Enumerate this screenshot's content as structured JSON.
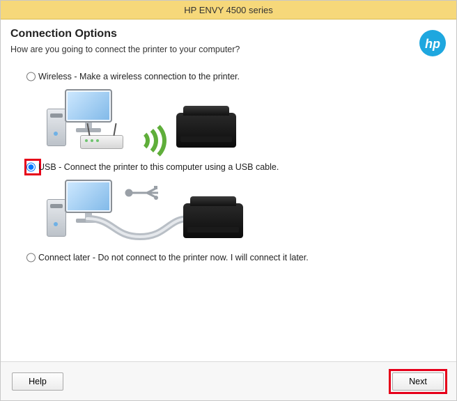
{
  "window": {
    "title": "HP ENVY 4500 series"
  },
  "header": {
    "heading": "Connection Options",
    "subheading": "How are you going to connect the printer to your computer?"
  },
  "options": {
    "wireless": {
      "label": "Wireless - Make a wireless connection to the printer.",
      "selected": false
    },
    "usb": {
      "label": "USB - Connect the printer to this computer using a USB cable.",
      "selected": true,
      "highlighted": true
    },
    "later": {
      "label": "Connect later - Do not connect to the printer now. I will connect it later.",
      "selected": false
    }
  },
  "footer": {
    "help_label": "Help",
    "next_label": "Next",
    "next_highlighted": true
  },
  "brand": {
    "logo_text": "hp"
  }
}
